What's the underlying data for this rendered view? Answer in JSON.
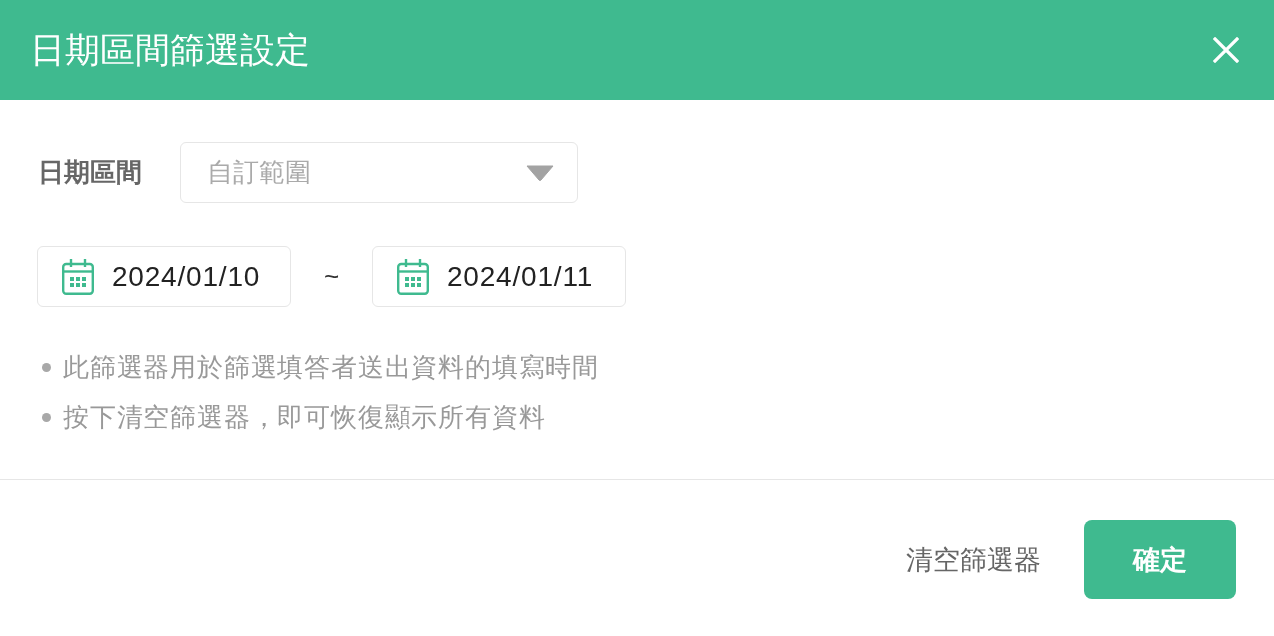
{
  "dialog": {
    "title": "日期區間篩選設定"
  },
  "date_range": {
    "label": "日期區間",
    "placeholder": "自訂範圍"
  },
  "dates": {
    "start": "2024/01/10",
    "separator": "~",
    "end": "2024/01/11"
  },
  "notes": [
    "此篩選器用於篩選填答者送出資料的填寫時間",
    "按下清空篩選器，即可恢復顯示所有資料"
  ],
  "buttons": [
    {
      "label": "清空篩選器",
      "kind": "text"
    },
    {
      "label": "確定",
      "kind": "primary"
    }
  ]
}
